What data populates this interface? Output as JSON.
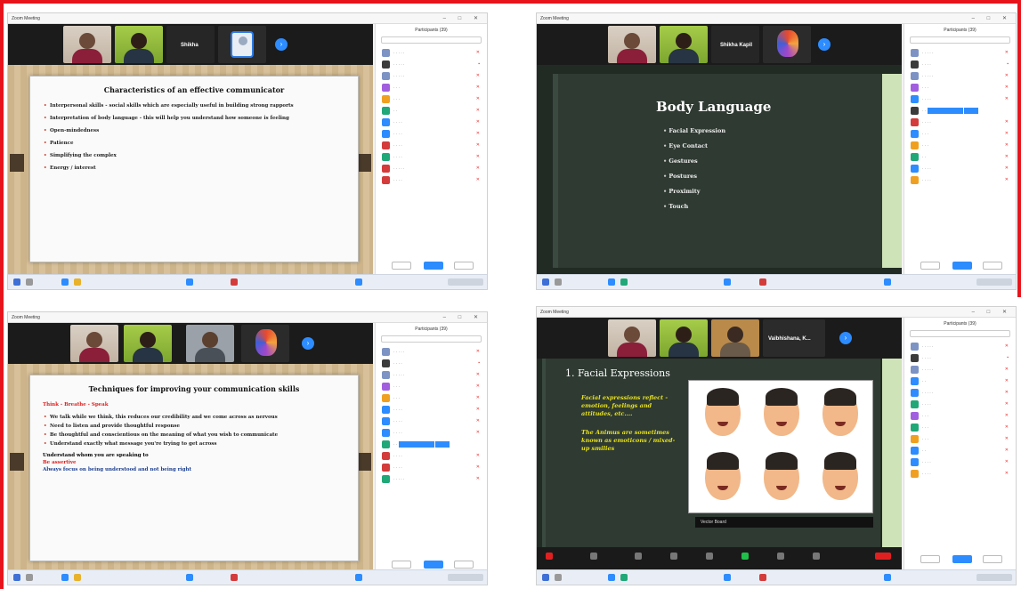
{
  "window_title": "Zoom Meeting",
  "panel_title": "Participants (39)",
  "s1": {
    "names": [
      "Shikha"
    ],
    "slide_title": "Characteristics of an effective communicator",
    "bullets": [
      {
        "text": "Interpersonal skills - social skills which are especially useful in building strong rapports",
        "accent": false
      },
      {
        "text": "Interpretation of body language - this will help you understand how someone is feeling",
        "accent": false
      },
      {
        "text": "Open-mindedness",
        "accent": true
      },
      {
        "text": "Patience",
        "accent": false
      },
      {
        "text": "Simplifying the complex",
        "accent": false
      },
      {
        "text": "Energy / interest",
        "accent": true
      }
    ]
  },
  "s2": {
    "names": [
      "Shikha Kapil"
    ],
    "slide_title": "Body Language",
    "bullets": [
      "Facial Expression",
      "Eye Contact",
      "Gestures",
      "Postures",
      "Proximity",
      "Touch"
    ]
  },
  "s3": {
    "slide_title": "Techniques for improving your communication skills",
    "sub": "Think - Breathe - Speak",
    "bullets": [
      "We talk while we think, this reduces our credibility and we come across as nervous",
      "Need to listen and provide thoughtful response",
      "Be thoughtful and conscientious on the meaning of what you wish to communicate",
      "Understand exactly what message you're trying to get across"
    ],
    "foot1": "Understand whom you are speaking to",
    "foot2": "Be assertive",
    "foot3": "Always focus on being understood and not being right"
  },
  "s4": {
    "names": [
      "Vaibhishana, K..."
    ],
    "slide_title": "1. Facial Expressions",
    "p1": "Facial expressions reflect - emotion, feelings and attitudes, etc....",
    "p2": "The Animus are sometimes known as emoticons / mixed-up smilies",
    "caption": "Vector Board"
  },
  "colors": {
    "frame": "#e8141c",
    "zoom_blue": "#2d8cff",
    "highlight_red": "#e11b1b",
    "chalk_yellow": "#e9e21b"
  }
}
